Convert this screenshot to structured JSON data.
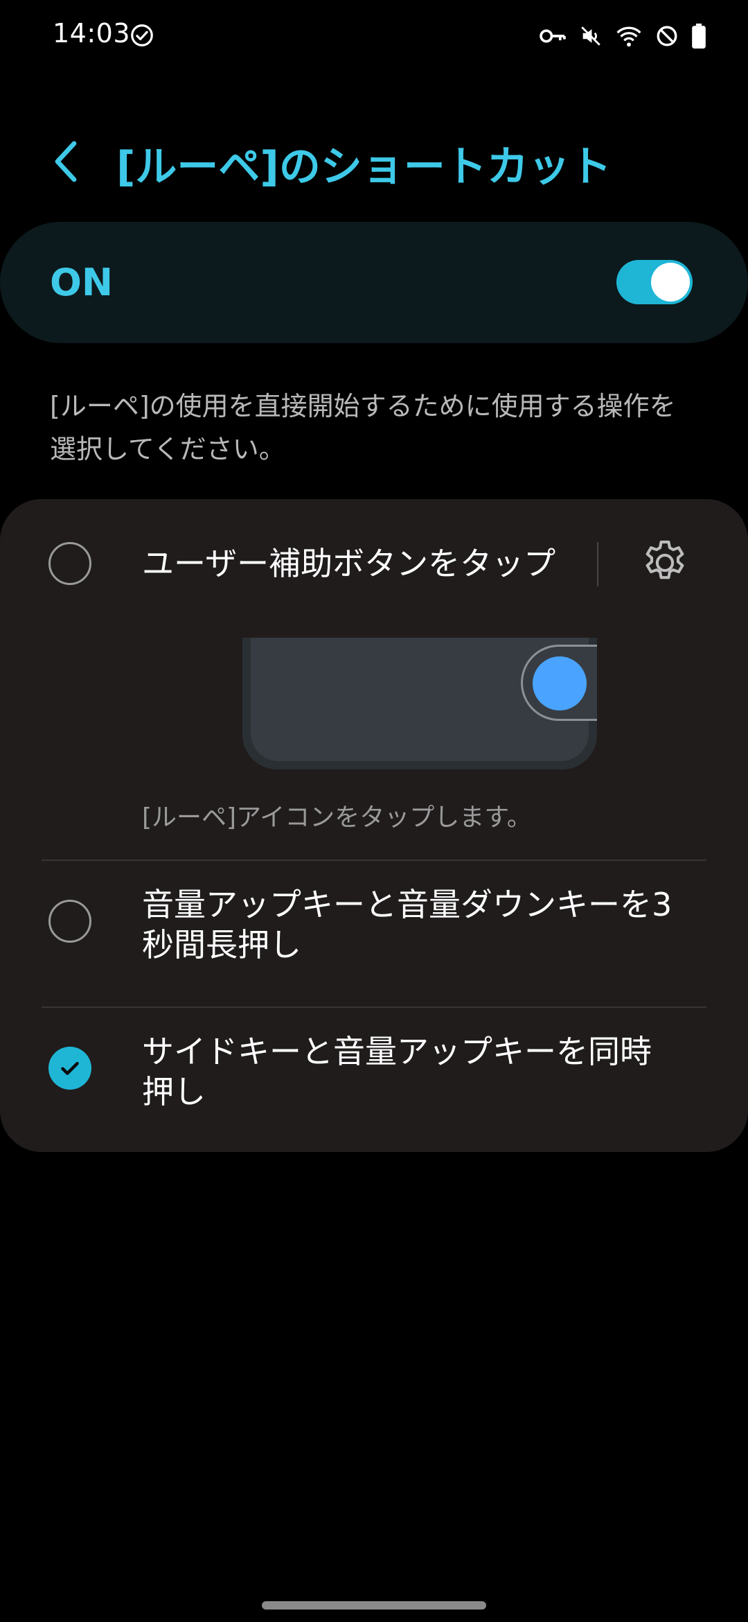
{
  "status_bar": {
    "time": "14:03"
  },
  "header": {
    "title": "[ルーペ]のショートカット"
  },
  "master_switch": {
    "label": "ON",
    "state": "on"
  },
  "description": "[ルーペ]の使用を直接開始するために使用する操作を選択してください。",
  "options": [
    {
      "label": "ユーザー補助ボタンをタップ",
      "hint": "[ルーペ]アイコンをタップします。",
      "checked": false,
      "has_settings": true
    },
    {
      "label_line1": "音量アップキーと音量ダウンキーを3",
      "label_line2": "秒間長押し",
      "checked": false
    },
    {
      "label_line1": "サイドキーと音量アップキーを同時",
      "label_line2": "押し",
      "checked": true
    }
  ],
  "colors": {
    "accent": "#3ec9e8",
    "toggle": "#1fb6d6",
    "card": "#201c1c",
    "background": "#000000"
  },
  "icons": {
    "back": "chevron-left-icon",
    "settings": "gear-icon",
    "status": [
      "check-circle-icon",
      "key-icon",
      "mute-icon",
      "wifi-icon",
      "do-not-disturb-icon",
      "battery-icon"
    ]
  }
}
